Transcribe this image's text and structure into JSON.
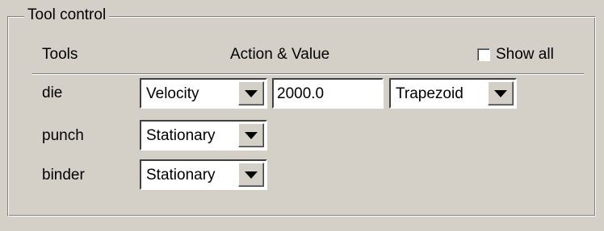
{
  "group": {
    "title": "Tool control"
  },
  "header": {
    "tools": "Tools",
    "action_value": "Action & Value",
    "show_all_label": "Show all",
    "show_all_checked": false
  },
  "rows": [
    {
      "tool": "die",
      "action": "Velocity",
      "value": "2000.0",
      "profile": "Trapezoid"
    },
    {
      "tool": "punch",
      "action": "Stationary"
    },
    {
      "tool": "binder",
      "action": "Stationary"
    }
  ]
}
